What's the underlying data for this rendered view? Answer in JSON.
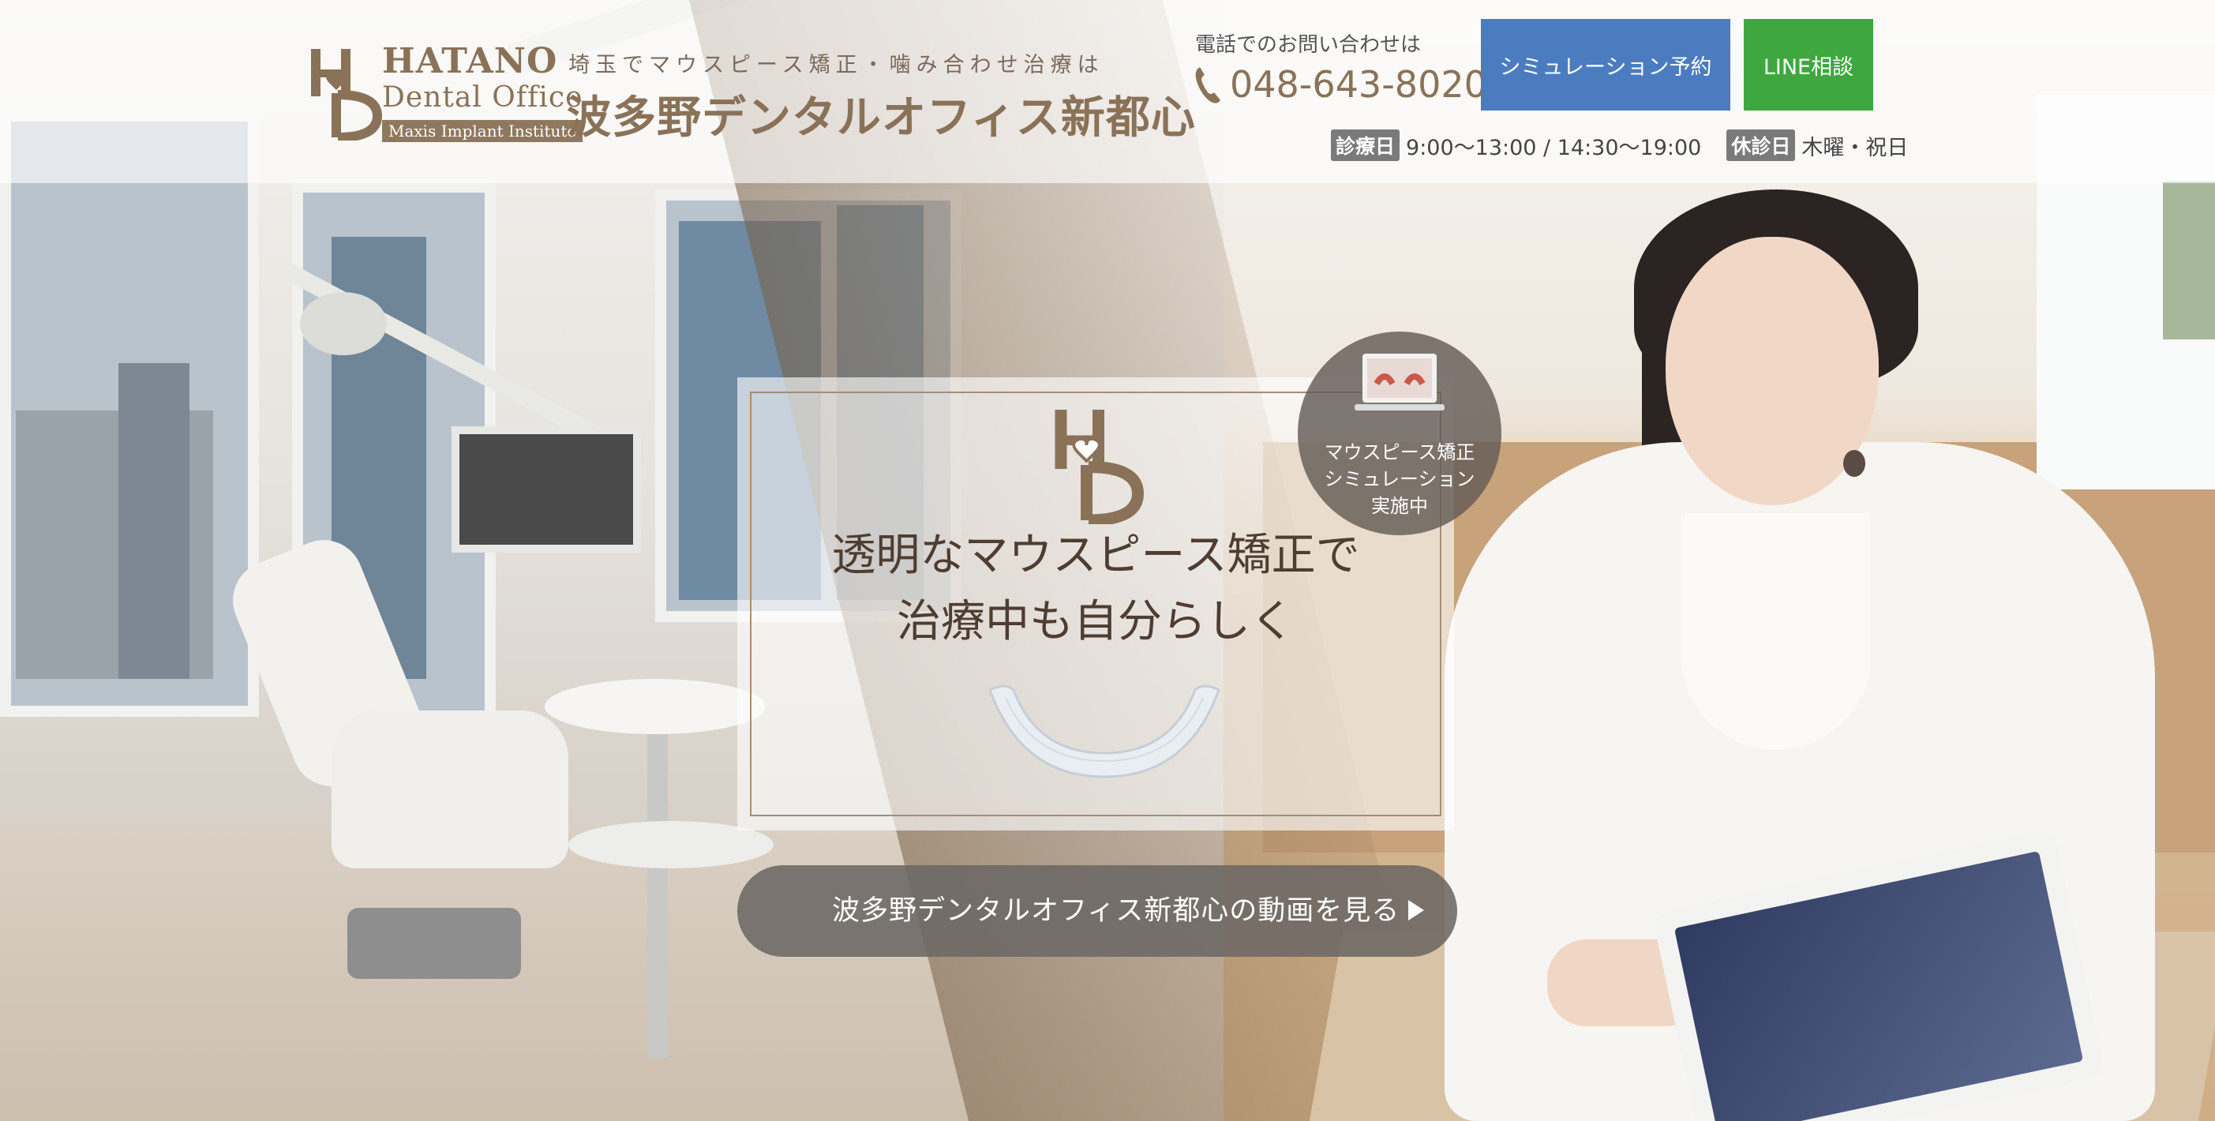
{
  "header": {
    "logo": {
      "line1": "HATANO",
      "line2": "Dental Office",
      "line3": "Maxis Implant Institute"
    },
    "tagline": "埼玉でマウスピース矯正・噛み合わせ治療は",
    "clinic_name": "波多野デンタルオフィス新都心",
    "phone_label": "電話でのお問い合わせは",
    "phone_number": "048-643-8020",
    "buttons": {
      "simulation": "シミュレーション予約",
      "line": "LINE相談"
    },
    "hours": {
      "open_tag": "診療日",
      "open_hours": "9:00〜13:00 / 14:30〜19:00",
      "closed_tag": "休診日",
      "closed_days": "木曜・祝日"
    }
  },
  "hero": {
    "title_line1": "透明なマウスピース矯正で",
    "title_line2": "治療中も自分らしく",
    "badge": {
      "line1": "マウスピース矯正",
      "line2": "シミュレーション",
      "line3": "実施中"
    },
    "video_button": "波多野デンタルオフィス新都心の動画を見る"
  },
  "icons": {
    "phone": "phone-icon",
    "play": "play-icon",
    "logo": "hd-logo-icon"
  },
  "colors": {
    "brand_brown": "#8a7258",
    "simulation_button": "#4b7cc0",
    "line_button": "#3ea73f",
    "tag_gray": "#7a7a7a"
  }
}
